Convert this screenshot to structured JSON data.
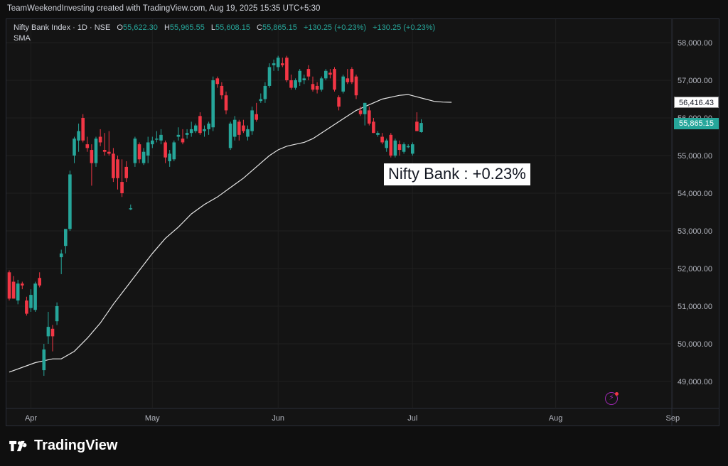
{
  "header": {
    "attribution": "TeamWeekendInvesting created with TradingView.com, Aug 19, 2025 15:35 UTC+5:30"
  },
  "legend": {
    "symbol": "Nifty Bank Index · 1D · NSE",
    "o_label": "O",
    "o_value": "55,622.30",
    "h_label": "H",
    "h_value": "55,965.55",
    "l_label": "L",
    "l_value": "55,608.15",
    "c_label": "C",
    "c_value": "55,865.15",
    "change1": "+130.25 (+0.23%)",
    "change2": "+130.25 (+0.23%)",
    "indicator": "SMA"
  },
  "annotation": "Nifty Bank : +0.23%",
  "price_tags": {
    "sma": "56,416.43",
    "close": "55,865.15"
  },
  "logo": {
    "text": "TradingView"
  },
  "colors": {
    "up": "#26a69a",
    "down": "#f23645",
    "sma": "#e6e6e6",
    "grid": "#1f1f1f",
    "axis_text": "#b2b5be"
  },
  "chart_data": {
    "type": "candlestick",
    "title": "Nifty Bank Index · 1D · NSE",
    "ylim": [
      48500,
      58500
    ],
    "y_ticks": [
      {
        "value": 49000,
        "label": "49,000.00"
      },
      {
        "value": 50000,
        "label": "50,000.00"
      },
      {
        "value": 51000,
        "label": "51,000.00"
      },
      {
        "value": 52000,
        "label": "52,000.00"
      },
      {
        "value": 53000,
        "label": "53,000.00"
      },
      {
        "value": 54000,
        "label": "54,000.00"
      },
      {
        "value": 55000,
        "label": "55,000.00"
      },
      {
        "value": 56000,
        "label": "56,000.00"
      },
      {
        "value": 57000,
        "label": "57,000.00"
      },
      {
        "value": 58000,
        "label": "58,000.00"
      }
    ],
    "x_ticks": [
      {
        "index": 5,
        "label": "Apr"
      },
      {
        "index": 33,
        "label": "May"
      },
      {
        "index": 62,
        "label": "Jun"
      },
      {
        "index": 93,
        "label": "Jul"
      },
      {
        "index": 126,
        "label": "Aug"
      },
      {
        "index": 153,
        "label": "Sep"
      }
    ],
    "candles": [
      {
        "o": 51900,
        "h": 51950,
        "l": 51150,
        "c": 51200
      },
      {
        "o": 51650,
        "h": 51800,
        "l": 51200,
        "c": 51200
      },
      {
        "o": 51150,
        "h": 51700,
        "l": 51050,
        "c": 51600
      },
      {
        "o": 51600,
        "h": 51650,
        "l": 51450,
        "c": 51550
      },
      {
        "o": 51150,
        "h": 51250,
        "l": 50750,
        "c": 50800
      },
      {
        "o": 50950,
        "h": 51450,
        "l": 50850,
        "c": 51300
      },
      {
        "o": 50900,
        "h": 51650,
        "l": 50850,
        "c": 51600
      },
      {
        "o": 51750,
        "h": 51900,
        "l": 51500,
        "c": 51550
      },
      {
        "o": 49300,
        "h": 50000,
        "l": 49150,
        "c": 49850
      },
      {
        "o": 50200,
        "h": 50850,
        "l": 50000,
        "c": 50450
      },
      {
        "o": 50400,
        "h": 50500,
        "l": 49800,
        "c": 50200
      },
      {
        "o": 50600,
        "h": 51100,
        "l": 50500,
        "c": 51000
      },
      {
        "o": 52300,
        "h": 52500,
        "l": 51850,
        "c": 52400
      },
      {
        "o": 52600,
        "h": 53050,
        "l": 52400,
        "c": 53050
      },
      {
        "o": 53050,
        "h": 54600,
        "l": 53000,
        "c": 54500
      },
      {
        "o": 55000,
        "h": 55500,
        "l": 54800,
        "c": 55450
      },
      {
        "o": 55400,
        "h": 55850,
        "l": 55100,
        "c": 55650
      },
      {
        "o": 56000,
        "h": 56100,
        "l": 55350,
        "c": 55400
      },
      {
        "o": 55300,
        "h": 55500,
        "l": 55100,
        "c": 55200
      },
      {
        "o": 55150,
        "h": 55300,
        "l": 54200,
        "c": 54800
      },
      {
        "o": 54800,
        "h": 55500,
        "l": 54700,
        "c": 55450
      },
      {
        "o": 55500,
        "h": 55700,
        "l": 55250,
        "c": 55350
      },
      {
        "o": 55150,
        "h": 55600,
        "l": 55000,
        "c": 55100
      },
      {
        "o": 55100,
        "h": 55650,
        "l": 55000,
        "c": 55050
      },
      {
        "o": 55050,
        "h": 55200,
        "l": 54300,
        "c": 54400
      },
      {
        "o": 54900,
        "h": 55000,
        "l": 54100,
        "c": 54400
      },
      {
        "o": 54300,
        "h": 54900,
        "l": 53900,
        "c": 54000
      },
      {
        "o": 54700,
        "h": 54850,
        "l": 54300,
        "c": 54400
      },
      {
        "o": 53600,
        "h": 53700,
        "l": 53550,
        "c": 53600
      },
      {
        "o": 54800,
        "h": 55500,
        "l": 54700,
        "c": 55450
      },
      {
        "o": 55300,
        "h": 55350,
        "l": 54800,
        "c": 54900
      },
      {
        "o": 54800,
        "h": 55200,
        "l": 54750,
        "c": 55100
      },
      {
        "o": 55000,
        "h": 55500,
        "l": 54800,
        "c": 55350
      },
      {
        "o": 55300,
        "h": 55500,
        "l": 55200,
        "c": 55400
      },
      {
        "o": 55450,
        "h": 55650,
        "l": 55350,
        "c": 55450
      },
      {
        "o": 55400,
        "h": 55700,
        "l": 55300,
        "c": 55550
      },
      {
        "o": 55350,
        "h": 55400,
        "l": 54800,
        "c": 54950
      },
      {
        "o": 54850,
        "h": 55150,
        "l": 54700,
        "c": 55050
      },
      {
        "o": 54900,
        "h": 55400,
        "l": 54850,
        "c": 55350
      },
      {
        "o": 55500,
        "h": 55750,
        "l": 55400,
        "c": 55550
      },
      {
        "o": 55450,
        "h": 55700,
        "l": 55300,
        "c": 55350
      },
      {
        "o": 55550,
        "h": 55700,
        "l": 55450,
        "c": 55600
      },
      {
        "o": 55600,
        "h": 55900,
        "l": 55500,
        "c": 55700
      },
      {
        "o": 55650,
        "h": 55850,
        "l": 55600,
        "c": 55800
      },
      {
        "o": 56050,
        "h": 56150,
        "l": 55550,
        "c": 55600
      },
      {
        "o": 55650,
        "h": 55800,
        "l": 55500,
        "c": 55700
      },
      {
        "o": 55700,
        "h": 55900,
        "l": 55550,
        "c": 55850
      },
      {
        "o": 55750,
        "h": 57100,
        "l": 55650,
        "c": 57000
      },
      {
        "o": 57050,
        "h": 57100,
        "l": 56800,
        "c": 56900
      },
      {
        "o": 56850,
        "h": 56950,
        "l": 56500,
        "c": 56600
      },
      {
        "o": 56600,
        "h": 56700,
        "l": 56100,
        "c": 56200
      },
      {
        "o": 55200,
        "h": 55900,
        "l": 55150,
        "c": 55850
      },
      {
        "o": 55500,
        "h": 56050,
        "l": 55400,
        "c": 55950
      },
      {
        "o": 55900,
        "h": 55950,
        "l": 55400,
        "c": 55550
      },
      {
        "o": 55800,
        "h": 55950,
        "l": 55600,
        "c": 55650
      },
      {
        "o": 55500,
        "h": 55800,
        "l": 55400,
        "c": 55700
      },
      {
        "o": 55650,
        "h": 56300,
        "l": 55550,
        "c": 56200
      },
      {
        "o": 56100,
        "h": 56400,
        "l": 55900,
        "c": 55950
      },
      {
        "o": 56450,
        "h": 56650,
        "l": 56400,
        "c": 56500
      },
      {
        "o": 56500,
        "h": 56950,
        "l": 56400,
        "c": 56850
      },
      {
        "o": 56850,
        "h": 57450,
        "l": 56800,
        "c": 57350
      },
      {
        "o": 57400,
        "h": 57550,
        "l": 57250,
        "c": 57450
      },
      {
        "o": 57350,
        "h": 57650,
        "l": 57250,
        "c": 57600
      },
      {
        "o": 57450,
        "h": 57600,
        "l": 57350,
        "c": 57400
      },
      {
        "o": 57600,
        "h": 57650,
        "l": 56950,
        "c": 57000
      },
      {
        "o": 57000,
        "h": 57150,
        "l": 56750,
        "c": 56800
      },
      {
        "o": 56800,
        "h": 57050,
        "l": 56750,
        "c": 57000
      },
      {
        "o": 56950,
        "h": 57300,
        "l": 56850,
        "c": 57250
      },
      {
        "o": 57000,
        "h": 57150,
        "l": 56900,
        "c": 57050
      },
      {
        "o": 57300,
        "h": 57400,
        "l": 57000,
        "c": 57100
      },
      {
        "o": 56900,
        "h": 57100,
        "l": 56700,
        "c": 56750
      },
      {
        "o": 56850,
        "h": 56950,
        "l": 56650,
        "c": 56750
      },
      {
        "o": 56750,
        "h": 57100,
        "l": 56700,
        "c": 57050
      },
      {
        "o": 57050,
        "h": 57300,
        "l": 57000,
        "c": 57250
      },
      {
        "o": 57200,
        "h": 57300,
        "l": 57050,
        "c": 57150
      },
      {
        "o": 57300,
        "h": 57350,
        "l": 56700,
        "c": 56750
      },
      {
        "o": 56550,
        "h": 56600,
        "l": 56200,
        "c": 56300
      },
      {
        "o": 56700,
        "h": 57150,
        "l": 56650,
        "c": 57100
      },
      {
        "o": 57050,
        "h": 57300,
        "l": 56900,
        "c": 56950
      },
      {
        "o": 57300,
        "h": 57350,
        "l": 56900,
        "c": 56950
      },
      {
        "o": 57100,
        "h": 57150,
        "l": 56500,
        "c": 56600
      },
      {
        "o": 56200,
        "h": 56300,
        "l": 56050,
        "c": 56100
      },
      {
        "o": 56100,
        "h": 56400,
        "l": 55800,
        "c": 56400
      },
      {
        "o": 56200,
        "h": 56300,
        "l": 55800,
        "c": 55850
      },
      {
        "o": 55900,
        "h": 56000,
        "l": 55600,
        "c": 55600
      },
      {
        "o": 55550,
        "h": 55650,
        "l": 55500,
        "c": 55600
      },
      {
        "o": 55500,
        "h": 55600,
        "l": 55300,
        "c": 55350
      },
      {
        "o": 55200,
        "h": 55450,
        "l": 55100,
        "c": 55400
      },
      {
        "o": 55550,
        "h": 55600,
        "l": 54950,
        "c": 55000
      },
      {
        "o": 55000,
        "h": 55450,
        "l": 54950,
        "c": 55400
      },
      {
        "o": 55300,
        "h": 55400,
        "l": 55000,
        "c": 55150
      },
      {
        "o": 55100,
        "h": 55350,
        "l": 55050,
        "c": 55300
      },
      {
        "o": 55250,
        "h": 55300,
        "l": 55200,
        "c": 55250
      },
      {
        "o": 55050,
        "h": 55350,
        "l": 55000,
        "c": 55300
      },
      {
        "o": 55900,
        "h": 56150,
        "l": 55650,
        "c": 55650
      },
      {
        "o": 55622.3,
        "h": 55965.55,
        "l": 55608.15,
        "c": 55865.15
      }
    ],
    "sma_series": {
      "name": "SMA",
      "points": [
        [
          0,
          49250
        ],
        [
          6,
          49500
        ],
        [
          10,
          49600
        ],
        [
          12,
          49600
        ],
        [
          15,
          49800
        ],
        [
          18,
          50150
        ],
        [
          21,
          50550
        ],
        [
          24,
          51050
        ],
        [
          27,
          51500
        ],
        [
          30,
          51950
        ],
        [
          33,
          52400
        ],
        [
          36,
          52800
        ],
        [
          39,
          53100
        ],
        [
          42,
          53450
        ],
        [
          45,
          53700
        ],
        [
          48,
          53900
        ],
        [
          51,
          54150
        ],
        [
          54,
          54400
        ],
        [
          56,
          54600
        ],
        [
          58,
          54800
        ],
        [
          60,
          55000
        ],
        [
          62,
          55150
        ],
        [
          64,
          55250
        ],
        [
          66,
          55300
        ],
        [
          68,
          55350
        ],
        [
          70,
          55450
        ],
        [
          72,
          55600
        ],
        [
          74,
          55750
        ],
        [
          76,
          55900
        ],
        [
          78,
          56050
        ],
        [
          80,
          56200
        ],
        [
          82,
          56300
        ],
        [
          84,
          56400
        ],
        [
          86,
          56500
        ],
        [
          88,
          56550
        ],
        [
          90,
          56600
        ],
        [
          92,
          56620
        ],
        [
          94,
          56560
        ],
        [
          96,
          56500
        ],
        [
          97,
          56470
        ],
        [
          98,
          56440
        ],
        [
          100,
          56420
        ],
        [
          102,
          56416
        ]
      ]
    }
  }
}
